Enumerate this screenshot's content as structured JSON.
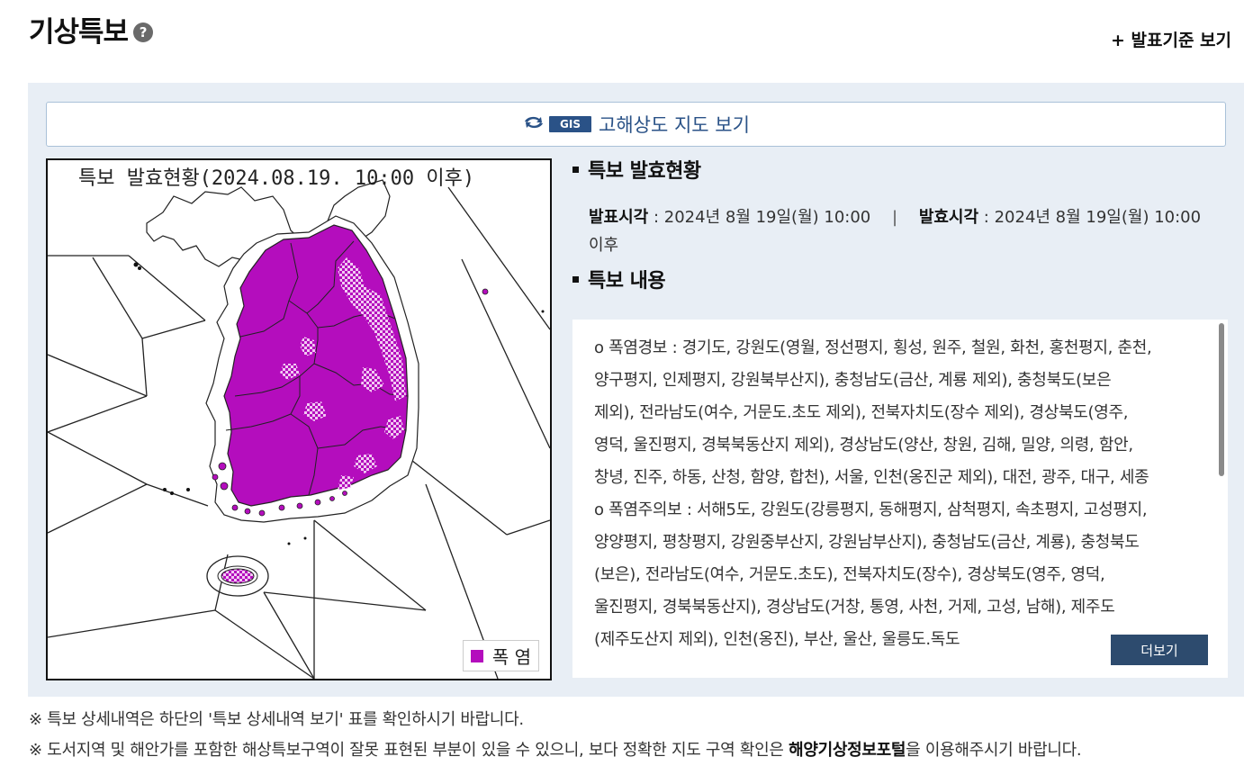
{
  "header": {
    "title": "기상특보",
    "help": "?",
    "criteria_link": "+ 발표기준 보기"
  },
  "gis": {
    "badge": "GIS",
    "label": "고해상도 지도 보기"
  },
  "map": {
    "title": "특보 발효현황(2024.08.19. 10:00 이후)",
    "legend_label": "폭 염",
    "legend_color": "#b40dbd",
    "highlight_color": "#b40dbd",
    "pattern_color": "#e8a6ea"
  },
  "status": {
    "section_title": "특보 발효현황",
    "announce_label": "발표시각",
    "announce_value": ": 2024년 8월 19일(월) 10:00",
    "separator": "|",
    "effective_label": "발효시각",
    "effective_value": ": 2024년 8월 19일(월) 10:00",
    "effective_suffix": "이후"
  },
  "content": {
    "section_title": "특보 내용",
    "lines": [
      "o 폭염경보 : 경기도, 강원도(영월, 정선평지, 횡성, 원주, 철원, 화천, 홍천평지, 춘천,",
      "양구평지, 인제평지, 강원북부산지), 충청남도(금산, 계룡 제외), 충청북도(보은",
      "제외), 전라남도(여수, 거문도.초도 제외), 전북자치도(장수 제외), 경상북도(영주,",
      "영덕, 울진평지, 경북북동산지 제외), 경상남도(양산, 창원, 김해, 밀양, 의령, 함안,",
      "창녕, 진주, 하동, 산청, 함양, 합천), 서울, 인천(옹진군 제외), 대전, 광주, 대구, 세종",
      "o 폭염주의보 : 서해5도, 강원도(강릉평지, 동해평지, 삼척평지, 속초평지, 고성평지,",
      "양양평지, 평창평지, 강원중부산지, 강원남부산지), 충청남도(금산, 계룡), 충청북도",
      "(보은), 전라남도(여수, 거문도.초도), 전북자치도(장수), 경상북도(영주, 영덕,",
      "울진평지, 경북북동산지), 경상남도(거창, 통영, 사천, 거제, 고성, 남해), 제주도",
      "(제주도산지 제외), 인천(옹진), 부산, 울산, 울릉도.독도"
    ],
    "more_button": "더보기"
  },
  "notes": {
    "note1": "※ 특보 상세내역은 하단의 '특보 상세내역 보기' 표를 확인하시기 바랍니다.",
    "note2_prefix": "※ 도서지역 및 해안가를 포함한 해상특보구역이 잘못 표현된 부분이 있을 수 있으니, 보다 정확한 지도 구역 확인은 ",
    "note2_bold": "해양기상정보포털",
    "note2_suffix": "을 이용해주시기 바랍니다."
  }
}
